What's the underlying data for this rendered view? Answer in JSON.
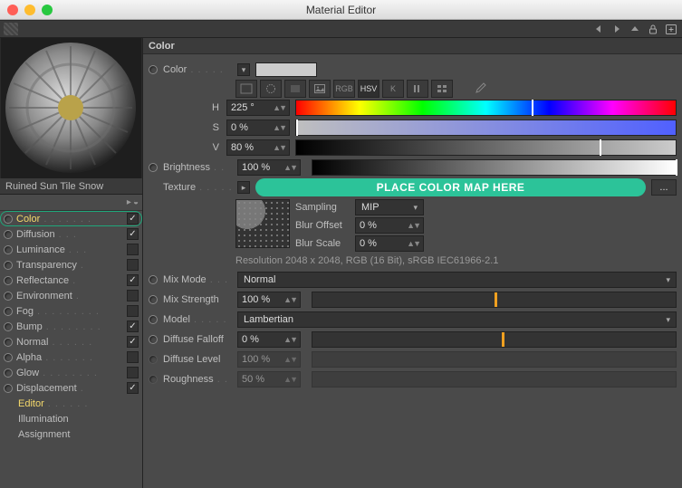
{
  "window": {
    "title": "Material Editor"
  },
  "material": {
    "name": "Ruined Sun Tile Snow"
  },
  "channels": [
    {
      "id": "color",
      "label": "Color",
      "checked": true,
      "active": true,
      "highlight": true
    },
    {
      "id": "diffusion",
      "label": "Diffusion",
      "checked": true
    },
    {
      "id": "luminance",
      "label": "Luminance",
      "checked": false
    },
    {
      "id": "transparency",
      "label": "Transparency",
      "checked": false
    },
    {
      "id": "reflectance",
      "label": "Reflectance",
      "checked": true
    },
    {
      "id": "environment",
      "label": "Environment",
      "checked": false
    },
    {
      "id": "fog",
      "label": "Fog",
      "checked": false
    },
    {
      "id": "bump",
      "label": "Bump",
      "checked": true
    },
    {
      "id": "normal",
      "label": "Normal",
      "checked": true
    },
    {
      "id": "alpha",
      "label": "Alpha",
      "checked": false
    },
    {
      "id": "glow",
      "label": "Glow",
      "checked": false
    },
    {
      "id": "displacement",
      "label": "Displacement",
      "checked": true
    }
  ],
  "subs": [
    {
      "label": "Editor",
      "highlight": true
    },
    {
      "label": "Illumination"
    },
    {
      "label": "Assignment"
    }
  ],
  "panel": {
    "title": "Color",
    "colorLabel": "Color",
    "h": {
      "label": "H",
      "value": "225 °",
      "marker": 62
    },
    "s": {
      "label": "S",
      "value": "0 %",
      "marker": 0
    },
    "v": {
      "label": "V",
      "value": "80 %",
      "marker": 80
    },
    "brightness": {
      "label": "Brightness",
      "value": "100 %",
      "marker": 100
    },
    "texture": {
      "label": "Texture",
      "placeholder": "PLACE COLOR MAP HERE",
      "dots": "..."
    },
    "sampling": {
      "label": "Sampling",
      "value": "MIP"
    },
    "blurOffset": {
      "label": "Blur Offset",
      "value": "0 %"
    },
    "blurScale": {
      "label": "Blur Scale",
      "value": "0 %"
    },
    "resolution": "Resolution 2048 x 2048, RGB (16 Bit), sRGB IEC61966-2.1",
    "mixMode": {
      "label": "Mix Mode",
      "value": "Normal"
    },
    "mixStrength": {
      "label": "Mix Strength",
      "value": "100 %",
      "knob": 50
    },
    "model": {
      "label": "Model",
      "value": "Lambertian"
    },
    "diffuseFalloff": {
      "label": "Diffuse Falloff",
      "value": "0 %",
      "knob": 52
    },
    "diffuseLevel": {
      "label": "Diffuse Level",
      "value": "100 %"
    },
    "roughness": {
      "label": "Roughness",
      "value": "50 %"
    },
    "tools": {
      "rgb": "RGB",
      "hsv": "HSV",
      "k": "K"
    }
  }
}
